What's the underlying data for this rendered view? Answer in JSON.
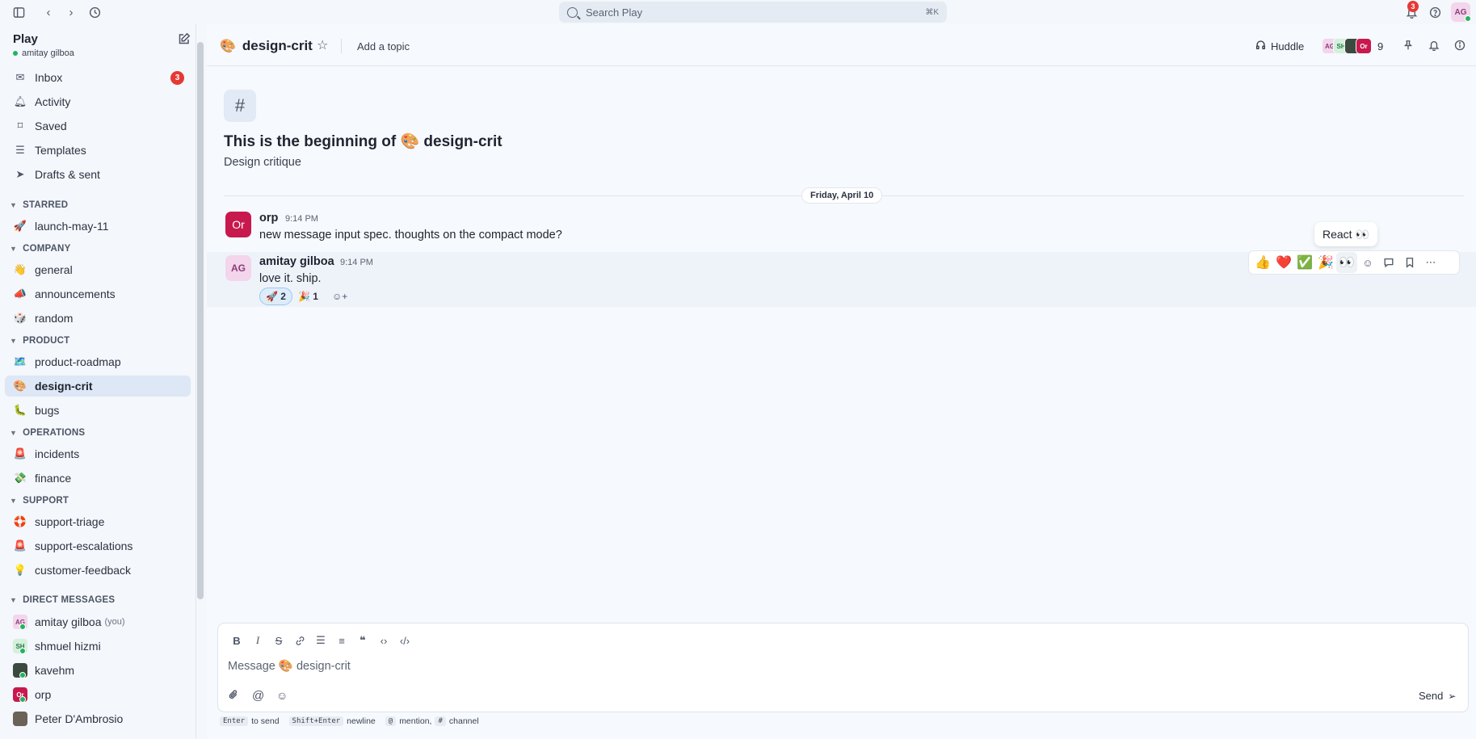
{
  "topbar": {
    "search_placeholder": "Search Play",
    "search_shortcut": "⌘K",
    "notification_count": "3",
    "user_initials": "AG"
  },
  "sidebar": {
    "workspace": "Play",
    "user": "amitay gilboa",
    "nav": [
      {
        "label": "Inbox",
        "count": "3"
      },
      {
        "label": "Activity"
      },
      {
        "label": "Saved"
      },
      {
        "label": "Templates"
      },
      {
        "label": "Drafts & sent"
      }
    ],
    "sections": {
      "starred": "STARRED",
      "company": "COMPANY",
      "product": "PRODUCT",
      "operations": "OPERATIONS",
      "support": "SUPPORT",
      "dms": "DIRECT MESSAGES"
    },
    "channels": {
      "launch": {
        "emoji": "🚀",
        "label": "launch-may-11"
      },
      "general": {
        "emoji": "👋",
        "label": "general"
      },
      "announcements": {
        "emoji": "📣",
        "label": "announcements"
      },
      "random": {
        "emoji": "🎲",
        "label": "random"
      },
      "roadmap": {
        "emoji": "🗺️",
        "label": "product-roadmap"
      },
      "designcrit": {
        "emoji": "🎨",
        "label": "design-crit"
      },
      "bugs": {
        "emoji": "🐛",
        "label": "bugs"
      },
      "incidents": {
        "emoji": "🚨",
        "label": "incidents"
      },
      "finance": {
        "emoji": "💸",
        "label": "finance"
      },
      "triage": {
        "emoji": "🛟",
        "label": "support-triage"
      },
      "escalations": {
        "emoji": "🚨",
        "label": "support-escalations"
      },
      "feedback": {
        "emoji": "💡",
        "label": "customer-feedback"
      }
    },
    "dms": [
      {
        "initials": "AG",
        "label": "amitay gilboa",
        "suffix": "(you)"
      },
      {
        "initials": "SH",
        "label": "shmuel hizmi"
      },
      {
        "initials": "",
        "label": "kavehm"
      },
      {
        "initials": "Or",
        "label": "orp"
      },
      {
        "initials": "",
        "label": "Peter D'Ambrosio"
      }
    ]
  },
  "channel": {
    "emoji": "🎨",
    "name": "design-crit",
    "topic": "Add a topic",
    "huddle": "Huddle",
    "member_count": "9",
    "members": [
      "AG",
      "SH",
      "",
      "Or"
    ]
  },
  "intro": {
    "title": "This is the beginning of 🎨 design-crit",
    "subtitle": "Design critique"
  },
  "date_divider": "Friday, April 10",
  "messages": [
    {
      "initials": "Or",
      "author": "orp",
      "time": "9:14 PM",
      "text": "new message input spec. thoughts on the compact mode?"
    },
    {
      "initials": "AG",
      "author": "amitay gilboa",
      "time": "9:14 PM",
      "text": "love it. ship.",
      "reactions": [
        {
          "emoji": "🚀",
          "count": "2"
        },
        {
          "emoji": "🎉",
          "count": "1"
        }
      ]
    }
  ],
  "hover_toolbar": {
    "quick_reactions": [
      "👍",
      "❤️",
      "✅",
      "🎉",
      "👀"
    ],
    "tooltip": "React 👀"
  },
  "composer": {
    "placeholder": "Message 🎨 design-crit",
    "send": "Send"
  },
  "hints": {
    "enter_key": "Enter",
    "enter_text": "to send",
    "shift_key": "Shift+Enter",
    "shift_text": "newline",
    "at_key": "@",
    "at_text": "mention,",
    "hash_key": "#",
    "hash_text": "channel"
  },
  "colors": {
    "badge": "#e53935",
    "online": "#22b35e",
    "active_channel_bg": "#dde7f5",
    "orp_avatar": "#c8194e"
  }
}
